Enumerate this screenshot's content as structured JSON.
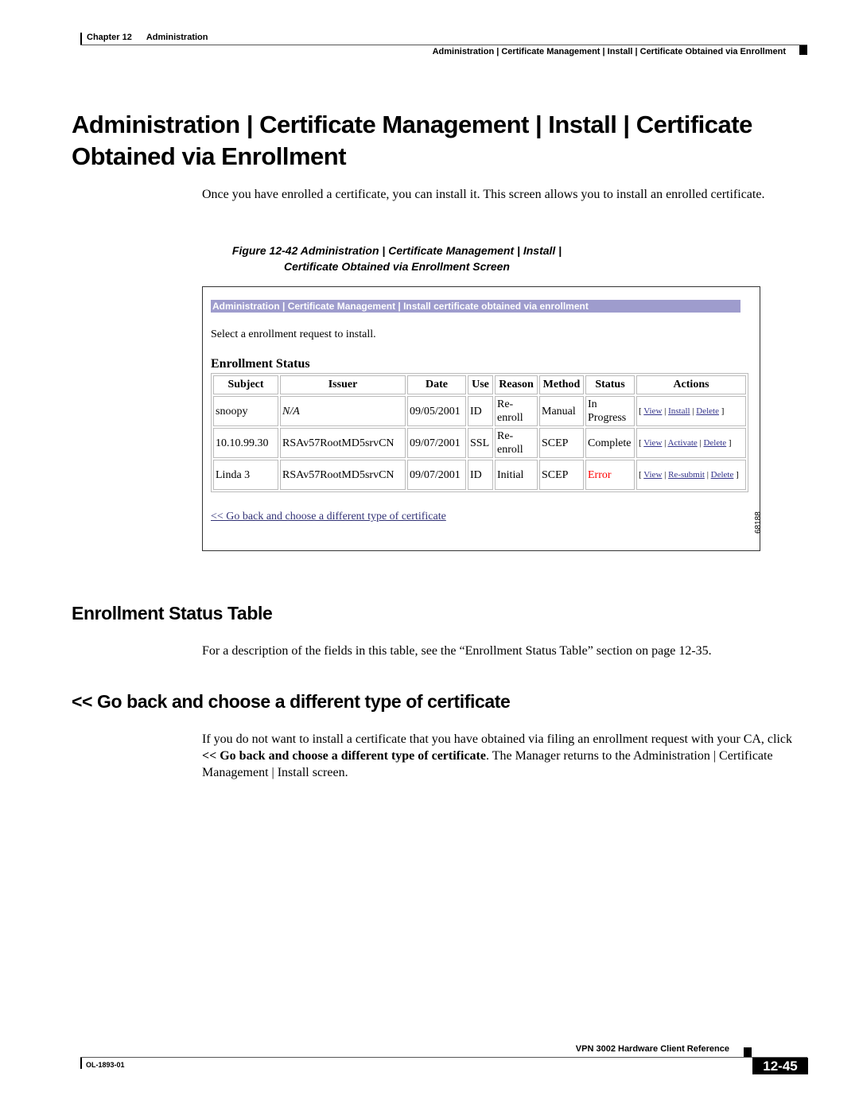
{
  "header": {
    "chapter_label": "Chapter 12",
    "chapter_title": "Administration",
    "breadcrumb": "Administration | Certificate Management | Install | Certificate Obtained via Enrollment"
  },
  "page_title": "Administration | Certificate Management | Install | Certificate Obtained via Enrollment",
  "intro_text": "Once you have enrolled a certificate, you can install it. This screen allows you to install an enrolled certificate.",
  "figure": {
    "caption_line1": "Figure 12-42 Administration | Certificate Management | Install |",
    "caption_line2": "Certificate Obtained via Enrollment Screen",
    "banner": "Administration | Certificate Management | Install certificate obtained via enrollment",
    "select_text": "Select a enrollment request to install.",
    "table_title": "Enrollment Status",
    "columns": [
      "Subject",
      "Issuer",
      "Date",
      "Use",
      "Reason",
      "Method",
      "Status",
      "Actions"
    ],
    "rows": [
      {
        "subject": "snoopy",
        "issuer": "N/A",
        "date": "09/05/2001",
        "use": "ID",
        "reason": "Re-enroll",
        "method": "Manual",
        "status": "In Progress",
        "actions": [
          "View",
          "Install",
          "Delete"
        ]
      },
      {
        "subject": "10.10.99.30",
        "issuer": "RSAv57RootMD5srvCN",
        "date": "09/07/2001",
        "use": "SSL",
        "reason": "Re-enroll",
        "method": "SCEP",
        "status": "Complete",
        "actions": [
          "View",
          "Activate",
          "Delete"
        ]
      },
      {
        "subject": "Linda 3",
        "issuer": "RSAv57RootMD5srvCN",
        "date": "09/07/2001",
        "use": "ID",
        "reason": "Initial",
        "method": "SCEP",
        "status": "Error",
        "actions": [
          "View",
          "Re-submit",
          "Delete"
        ]
      }
    ],
    "back_link": "<< Go back and choose a different type of certificate",
    "figure_id": "68188",
    "colors": {
      "banner": "#9e9ccd",
      "error": "#ff0000",
      "link": "#33338a"
    }
  },
  "sections": [
    {
      "heading": "Enrollment Status Table",
      "text": "For a description of the fields in this table, see the “Enrollment Status Table” section on page 12-35."
    },
    {
      "heading": "<< Go back and choose a different type of certificate",
      "text_before": "If you do not want to install a certificate that you have obtained via filing an enrollment request with your CA, click ",
      "text_bold": "<< Go back and choose a different type of certificate",
      "text_after": ". The Manager returns to the Administration | Certificate Management | Install screen."
    }
  ],
  "footer": {
    "book_title": "VPN 3002 Hardware Client Reference",
    "doc_number": "OL-1893-01",
    "page_number": "12-45"
  }
}
